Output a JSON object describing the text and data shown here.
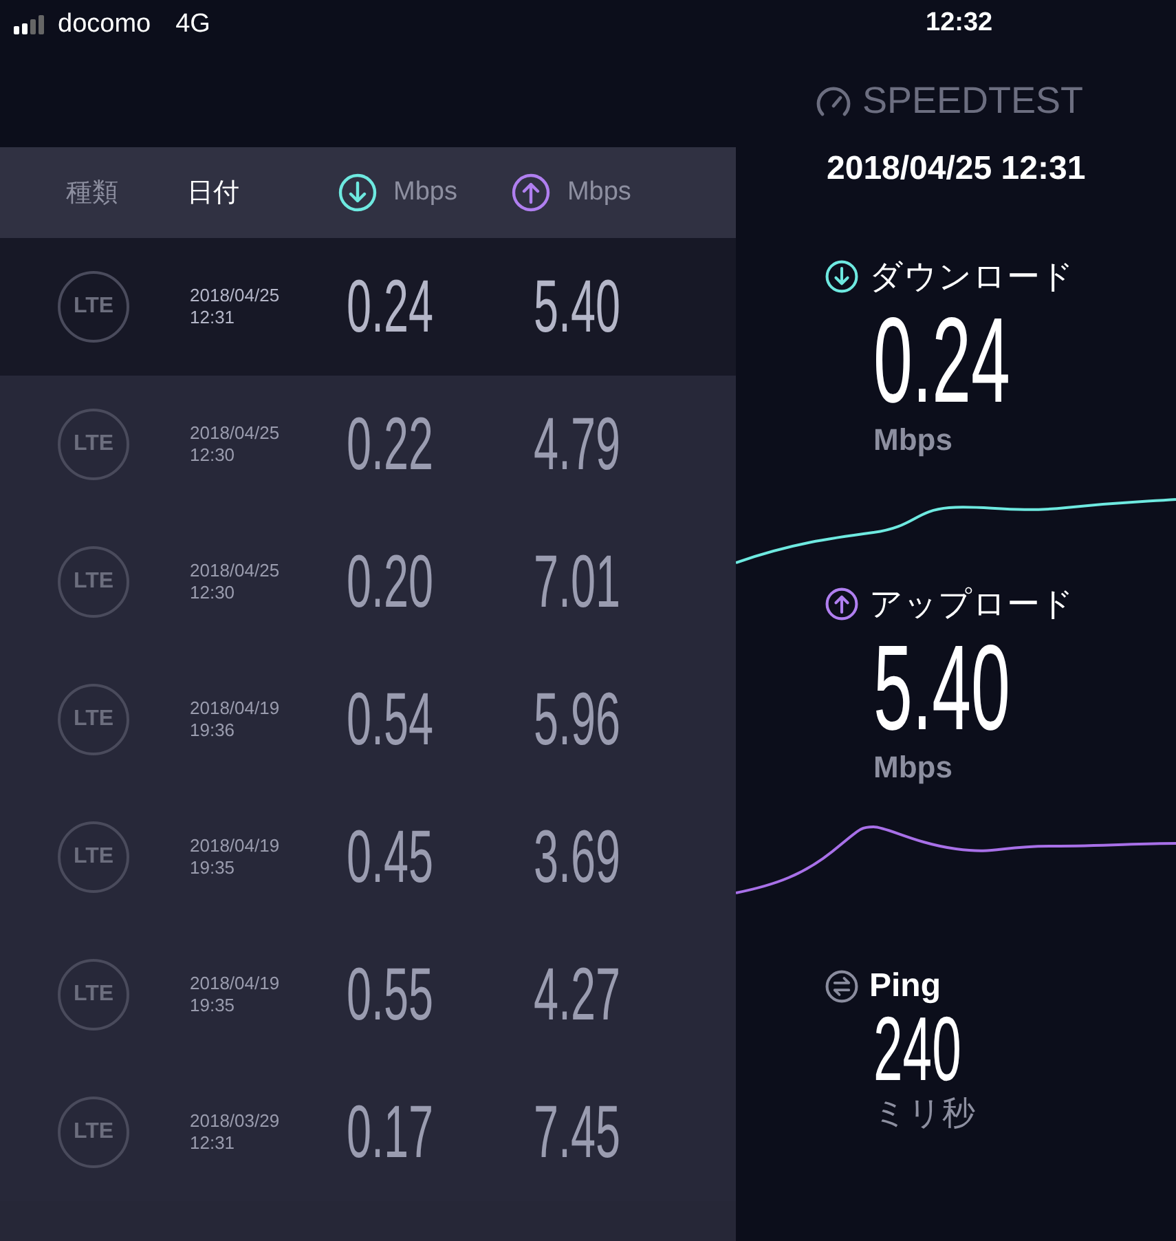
{
  "status_bar": {
    "carrier": "docomo",
    "network": "4G",
    "time": "12:32"
  },
  "brand": "SPEEDTEST",
  "history": {
    "columns": [
      {
        "label": "種類",
        "kind": "text",
        "selected": false
      },
      {
        "label": "日付",
        "kind": "text",
        "selected": true
      },
      {
        "label": "Mbps",
        "kind": "download",
        "selected": false
      },
      {
        "label": "Mbps",
        "kind": "upload",
        "selected": false
      }
    ],
    "rows": [
      {
        "type": "LTE",
        "date": "2018/04/25",
        "time": "12:31",
        "download": "0.24",
        "upload": "5.40",
        "selected": true
      },
      {
        "type": "LTE",
        "date": "2018/04/25",
        "time": "12:30",
        "download": "0.22",
        "upload": "4.79",
        "selected": false
      },
      {
        "type": "LTE",
        "date": "2018/04/25",
        "time": "12:30",
        "download": "0.20",
        "upload": "7.01",
        "selected": false
      },
      {
        "type": "LTE",
        "date": "2018/04/19",
        "time": "19:36",
        "download": "0.54",
        "upload": "5.96",
        "selected": false
      },
      {
        "type": "LTE",
        "date": "2018/04/19",
        "time": "19:35",
        "download": "0.45",
        "upload": "3.69",
        "selected": false
      },
      {
        "type": "LTE",
        "date": "2018/04/19",
        "time": "19:35",
        "download": "0.55",
        "upload": "4.27",
        "selected": false
      },
      {
        "type": "LTE",
        "date": "2018/03/29",
        "time": "12:31",
        "download": "0.17",
        "upload": "7.45",
        "selected": false
      }
    ]
  },
  "result": {
    "datetime": "2018/04/25 12:31",
    "download": {
      "label": "ダウンロード",
      "value": "0.24",
      "unit": "Mbps"
    },
    "upload": {
      "label": "アップロード",
      "value": "5.40",
      "unit": "Mbps"
    },
    "ping": {
      "label": "Ping",
      "value": "240",
      "unit": "ミリ秒"
    }
  }
}
